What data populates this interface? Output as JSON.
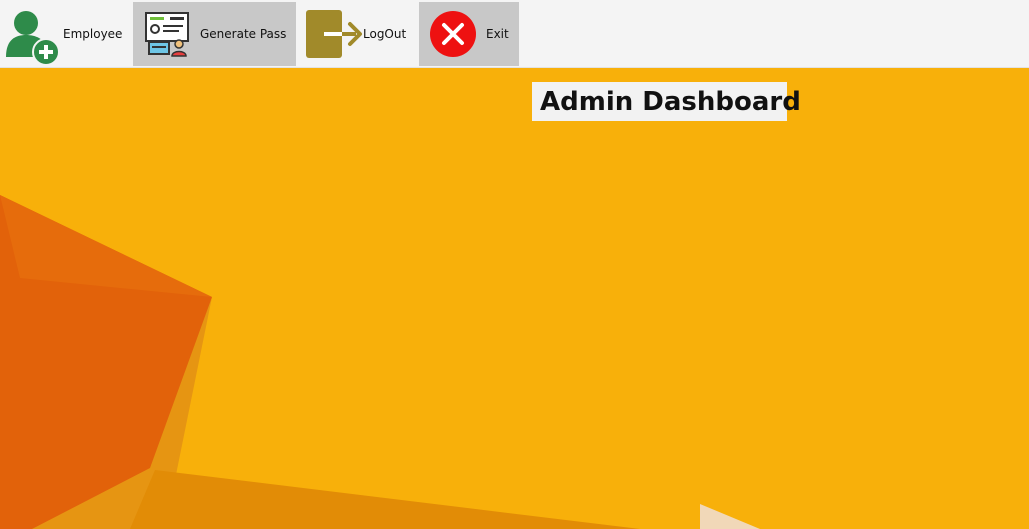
{
  "toolbar": {
    "employee": {
      "label": "Employee",
      "icon": "add-user-icon"
    },
    "generate_pass": {
      "label": "Generate Pass",
      "icon": "id-pass-icon"
    },
    "logout": {
      "label": "LogOut",
      "icon": "logout-icon"
    },
    "exit": {
      "label": "Exit",
      "icon": "close-icon"
    }
  },
  "main": {
    "title": "Admin Dashboard"
  },
  "colors": {
    "background": "#f8b00a",
    "shape_dark_orange": "#e2620a",
    "shape_mid_orange": "#e38a0a",
    "logout_gold": "#a18a2a",
    "exit_red": "#ee1111",
    "employee_green": "#2e8b4a"
  }
}
